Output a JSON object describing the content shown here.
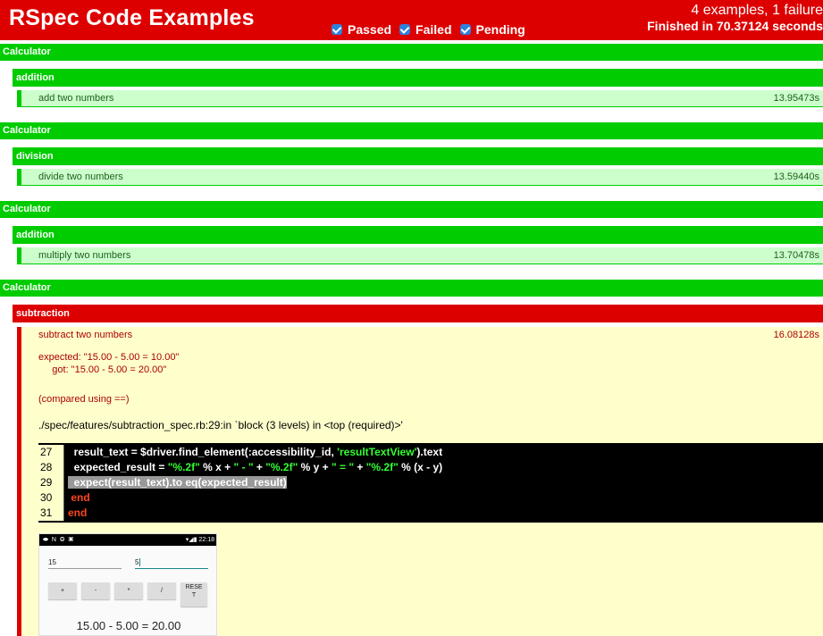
{
  "header": {
    "title": "RSpec Code Examples",
    "filters": [
      {
        "label": "Passed",
        "checked": true
      },
      {
        "label": "Failed",
        "checked": true
      },
      {
        "label": "Pending",
        "checked": true
      }
    ],
    "summary": "4 examples, 1 failure",
    "duration_prefix": "Finished in ",
    "duration_value": "70.37124 seconds"
  },
  "groups": [
    {
      "title": "Calculator",
      "subgroup": "addition",
      "example": {
        "name": "add two numbers",
        "time": "13.95473s",
        "status": "passed"
      }
    },
    {
      "title": "Calculator",
      "subgroup": "division",
      "example": {
        "name": "divide two numbers",
        "time": "13.59440s",
        "status": "passed"
      }
    },
    {
      "title": "Calculator",
      "subgroup": "addition",
      "example": {
        "name": "multiply two numbers",
        "time": "13.70478s",
        "status": "passed"
      }
    },
    {
      "title": "Calculator",
      "subgroup": "subtraction",
      "example": {
        "name": "subtract two numbers",
        "time": "16.08128s",
        "status": "failed"
      }
    }
  ],
  "failure": {
    "expected": "expected: \"15.00 - 5.00 = 10.00\"",
    "got": "     got: \"15.00 - 5.00 = 20.00\"",
    "compared": "(compared using ==)",
    "backtrace": "./spec/features/subtraction_spec.rb:29:in `block (3 levels) in <top (required)>'",
    "code": [
      {
        "num": "27",
        "pre": "  result_text = $driver.find_element(:accessibility_id, ",
        "str": "'resultTextView'",
        "post": ").text"
      },
      {
        "num": "28",
        "a": "  expected_result = ",
        "s1": "\"%.2f\"",
        "b": " % x + ",
        "s2": "\" - \"",
        "c": " + ",
        "s3": "\"%.2f\"",
        "d": " % y + ",
        "s4": "\" = \"",
        "e": " + ",
        "s5": "\"%.2f\"",
        "f": " % (x - y)"
      },
      {
        "num": "29",
        "text": "  expect(result_text).to eq(expected_result)"
      },
      {
        "num": "30",
        "text": " end"
      },
      {
        "num": "31",
        "text": "end"
      }
    ]
  },
  "screenshot": {
    "status_left": "⬬ N ◎ ▣",
    "status_right": "▾◢▮ 22:18",
    "input1": "15",
    "input2": "5",
    "buttons": [
      "+",
      "-",
      "*",
      "/",
      "RESE\nT"
    ],
    "result": "15.00 - 5.00 = 20.00"
  }
}
